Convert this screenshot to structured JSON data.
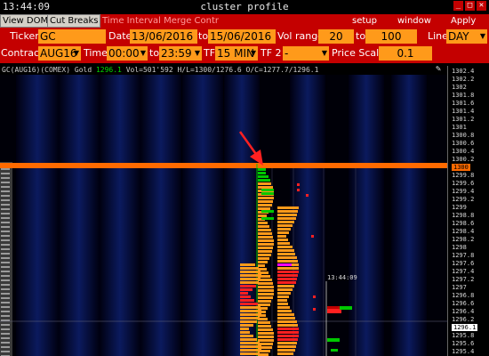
{
  "window": {
    "clock": "13:44:09",
    "title": "cluster profile",
    "buttons": [
      "_",
      "□",
      "✕"
    ]
  },
  "menubar": {
    "view_dom": "View DOM",
    "cut_breaks": "Cut Breaks",
    "time_interval_merge": "Time Interval Merge Contr",
    "setup": "setup",
    "window": "window",
    "apply": "Apply"
  },
  "controls": {
    "ticker_label": "Ticker",
    "ticker_value": "GC",
    "date_label": "Date",
    "date_from": "13/06/2016",
    "to_label": "to",
    "date_to": "15/06/2016",
    "vol_range_label": "Vol range",
    "vol_from": "20",
    "vol_to_label": "to",
    "vol_to": "100",
    "line_label": "Line",
    "line_value": "DAY",
    "contract_label": "Contract",
    "contract_value": "AUG16",
    "time_label": "Time",
    "time_from": "00:00",
    "time_to_label": "to",
    "time_to": "23:59",
    "tf_label": "TF",
    "tf_value": "15 MIN",
    "tf2_label": "TF 2",
    "tf2_value": "-",
    "price_scale_label": "Price Scale",
    "price_scale_value": "0.1"
  },
  "info": {
    "prefix": "GC(AUG16)(COMEX) Gold ",
    "last": "1296.1",
    "rest": " Vol=501'592 H/L=1300/1276.6 O/C=1277.7/1296.1"
  },
  "colors": {
    "header_red": "#c40000",
    "field_orange": "#ff9a1a",
    "profile_orange": "#ff9a1a",
    "high_line": "#ff6a00",
    "buy_green": "#00c800",
    "sell_red": "#ff2020",
    "poc_magenta": "#ff00ff",
    "annotation_arrow": "#ff2020"
  },
  "chart_data": {
    "type": "heatmap",
    "description_free": true,
    "price_axis_ticks": [
      "1302.4",
      "1302.2",
      "1302",
      "1301.8",
      "1301.6",
      "1301.4",
      "1301.2",
      "1301",
      "1300.8",
      "1300.6",
      "1300.4",
      "1300.2",
      "1300",
      "1299.8",
      "1299.6",
      "1299.4",
      "1299.2",
      "1299",
      "1298.8",
      "1298.6",
      "1298.4",
      "1298.2",
      "1298",
      "1297.8",
      "1297.6",
      "1297.4",
      "1297.2",
      "1297",
      "1296.8",
      "1296.6",
      "1296.4",
      "1296.2",
      "1296.1",
      "1295.8",
      "1295.6",
      "1295.4"
    ],
    "highlight_price": "1300",
    "current_price": "1296.1",
    "session_time_label": "13:44:09",
    "y_range": [
      1295.4,
      1302.4
    ]
  }
}
